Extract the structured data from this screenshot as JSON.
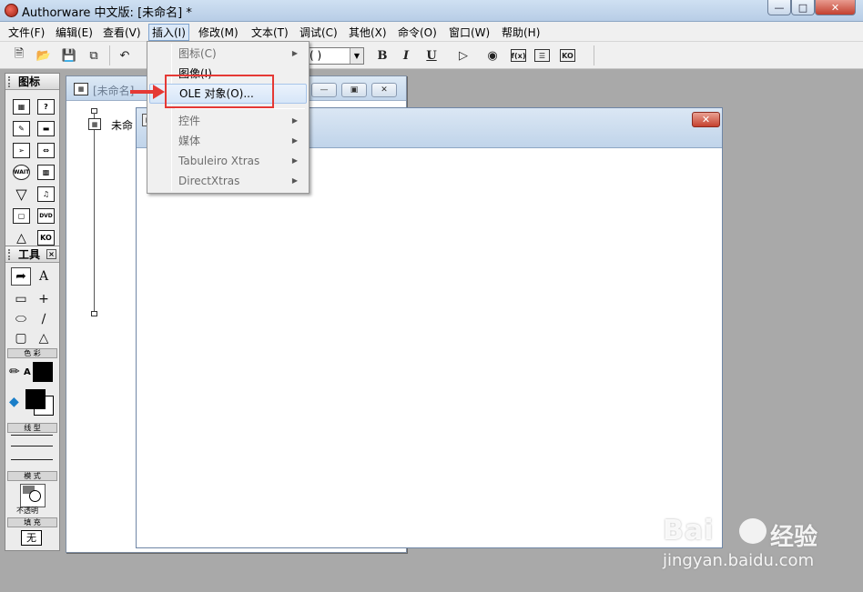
{
  "window": {
    "title": "Authorware 中文版: [未命名] *",
    "minimize_icon": "minimize-icon",
    "maximize_icon": "maximize-icon",
    "close_icon": "close-icon"
  },
  "menubar": {
    "items": [
      {
        "label": "文件(F)"
      },
      {
        "label": "编辑(E)"
      },
      {
        "label": "查看(V)"
      },
      {
        "label": "插入(I)",
        "active": true
      },
      {
        "label": "修改(M)"
      },
      {
        "label": "文本(T)"
      },
      {
        "label": "调试(C)"
      },
      {
        "label": "其他(X)"
      },
      {
        "label": "命令(O)"
      },
      {
        "label": "窗口(W)"
      },
      {
        "label": "帮助(H)"
      }
    ]
  },
  "toolbar": {
    "font_combo_value": "( )",
    "bold": "B",
    "italic": "I",
    "underline": "U",
    "icons": [
      "new-icon",
      "open-icon",
      "save-all-icon",
      "import-icon",
      "undo-icon",
      "run-icon",
      "control-panel-icon",
      "functions-icon",
      "variables-icon",
      "knowledge-objects-icon"
    ],
    "fx_label": "f(x)",
    "ko_label": "KO"
  },
  "insert_menu": {
    "items": [
      {
        "label": "图标(C)",
        "enabled": false,
        "submenu": true
      },
      {
        "label": "图像(I)",
        "enabled": true,
        "submenu": false
      },
      {
        "label": "OLE 对象(O)...",
        "enabled": true,
        "submenu": false,
        "highlighted": true
      },
      {
        "label": "控件",
        "enabled": false,
        "submenu": true
      },
      {
        "label": "媒体",
        "enabled": false,
        "submenu": true
      },
      {
        "label": "Tabuleiro Xtras",
        "enabled": false,
        "submenu": true
      },
      {
        "label": "DirectXtras",
        "enabled": false,
        "submenu": true
      }
    ]
  },
  "icon_palette": {
    "title": "图标",
    "icons": [
      "display-icon",
      "interaction-icon",
      "calculation-icon",
      "decision-icon",
      "navigate-icon",
      "motion-icon",
      "wait-icon",
      "video-icon",
      "erase-icon",
      "sound-icon",
      "framework-icon",
      "dvd-icon",
      "map-icon",
      "ko-icon"
    ],
    "wait_label": "WAIT",
    "dvd_label": "DVD",
    "ko_label": "KO"
  },
  "tools_palette": {
    "title": "工具",
    "tools": [
      "pointer-tool",
      "text-tool",
      "rectangle-tool",
      "crosshair-tool",
      "ellipse-tool",
      "line-tool",
      "rounded-rect-tool",
      "polygon-tool"
    ],
    "text_tool_label": "A",
    "color_label": "色 彩",
    "line_label": "线 型",
    "mode_label": "模 式",
    "mode_value": "不透明",
    "fill_label": "填 充",
    "fill_value": "无",
    "pen_color_suffix": "A",
    "colors": {
      "stroke": "#000000",
      "fill_fg": "#000000",
      "fill_bg": "#ffffff"
    }
  },
  "flowline_window": {
    "title": "[未命名]",
    "icon_label": "未命"
  },
  "presentation_window": {
    "title": "",
    "close_label": "x"
  },
  "watermark": {
    "brand": "Bai",
    "brand_cn": "经验",
    "url": "jingyan.baidu.com"
  },
  "colors": {
    "annotation": "#e53935",
    "desktop": "#a9a9a9",
    "menu_highlight": "#d7e6f8"
  }
}
